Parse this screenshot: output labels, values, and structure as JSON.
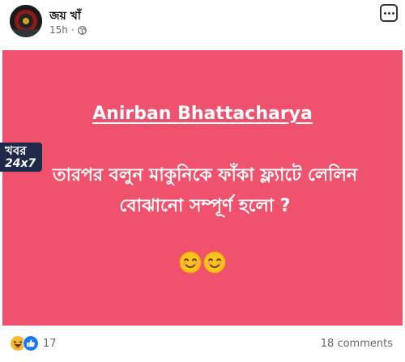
{
  "post": {
    "author": "জয় খাঁ",
    "time": "15h",
    "separator": "·",
    "privacy_icon": "globe-icon",
    "more_icon": "more-options-icon"
  },
  "card": {
    "background": "#f0516d",
    "title": "Anirban Bhattacharya",
    "body": "তারপর বলুন মাকুনিকে ফাঁকা ফ্ল্যাটে লেলিন বোঝানো সম্পূর্ণ হলো ?",
    "emoji": "smiling-face-icon",
    "logo_line1": "খবর",
    "logo_line2": "24x7"
  },
  "footer": {
    "reaction_icons": [
      "haha-reaction-icon",
      "like-reaction-icon"
    ],
    "reactions_count": "17",
    "comments": "18 comments"
  },
  "colors": {
    "like": "#1877f2",
    "haha": "#f7b928",
    "meta_text": "#65676b"
  }
}
